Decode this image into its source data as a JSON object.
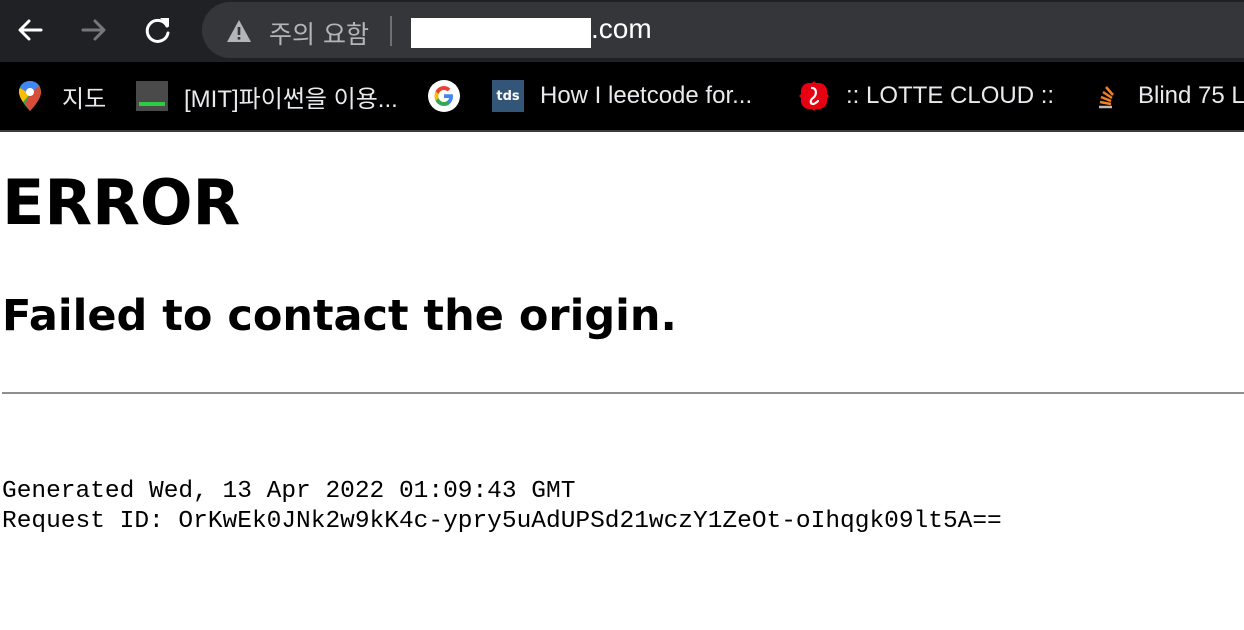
{
  "browser": {
    "back_icon": "arrow-left-icon",
    "forward_icon": "arrow-right-icon",
    "reload_icon": "reload-icon",
    "security_icon": "warning-triangle-icon",
    "security_label": "주의 요함",
    "url_suffix": ".com",
    "url_host_redacted": true
  },
  "bookmarks": [
    {
      "icon": "google-maps-pin-icon",
      "label": "지도"
    },
    {
      "icon": "terminal-favicon",
      "label": "[MIT]파이썬을 이용..."
    },
    {
      "icon": "google-g-icon",
      "label": ""
    },
    {
      "icon": "tds-favicon",
      "icon_text": "tds",
      "label": "How I leetcode for..."
    },
    {
      "icon": "lotte-logo-icon",
      "label": ":: LOTTE CLOUD ::"
    },
    {
      "icon": "stackoverflow-like-icon",
      "label": "Blind 75 L"
    }
  ],
  "page": {
    "title": "ERROR",
    "subtitle": "Failed to contact the origin.",
    "generated": "Generated Wed, 13 Apr 2022 01:09:43 GMT",
    "request_id": "Request ID: OrKwEk0JNk2w9kK4c-ypry5uAdUPSd21wczY1ZeOt-oIhqgk09lt5A=="
  },
  "colors": {
    "toolbar_bg": "#202124",
    "omnibox_bg": "#35363a",
    "bookmarks_bg": "#000000",
    "page_bg": "#ffffff",
    "rule": "#8e8e8e"
  }
}
